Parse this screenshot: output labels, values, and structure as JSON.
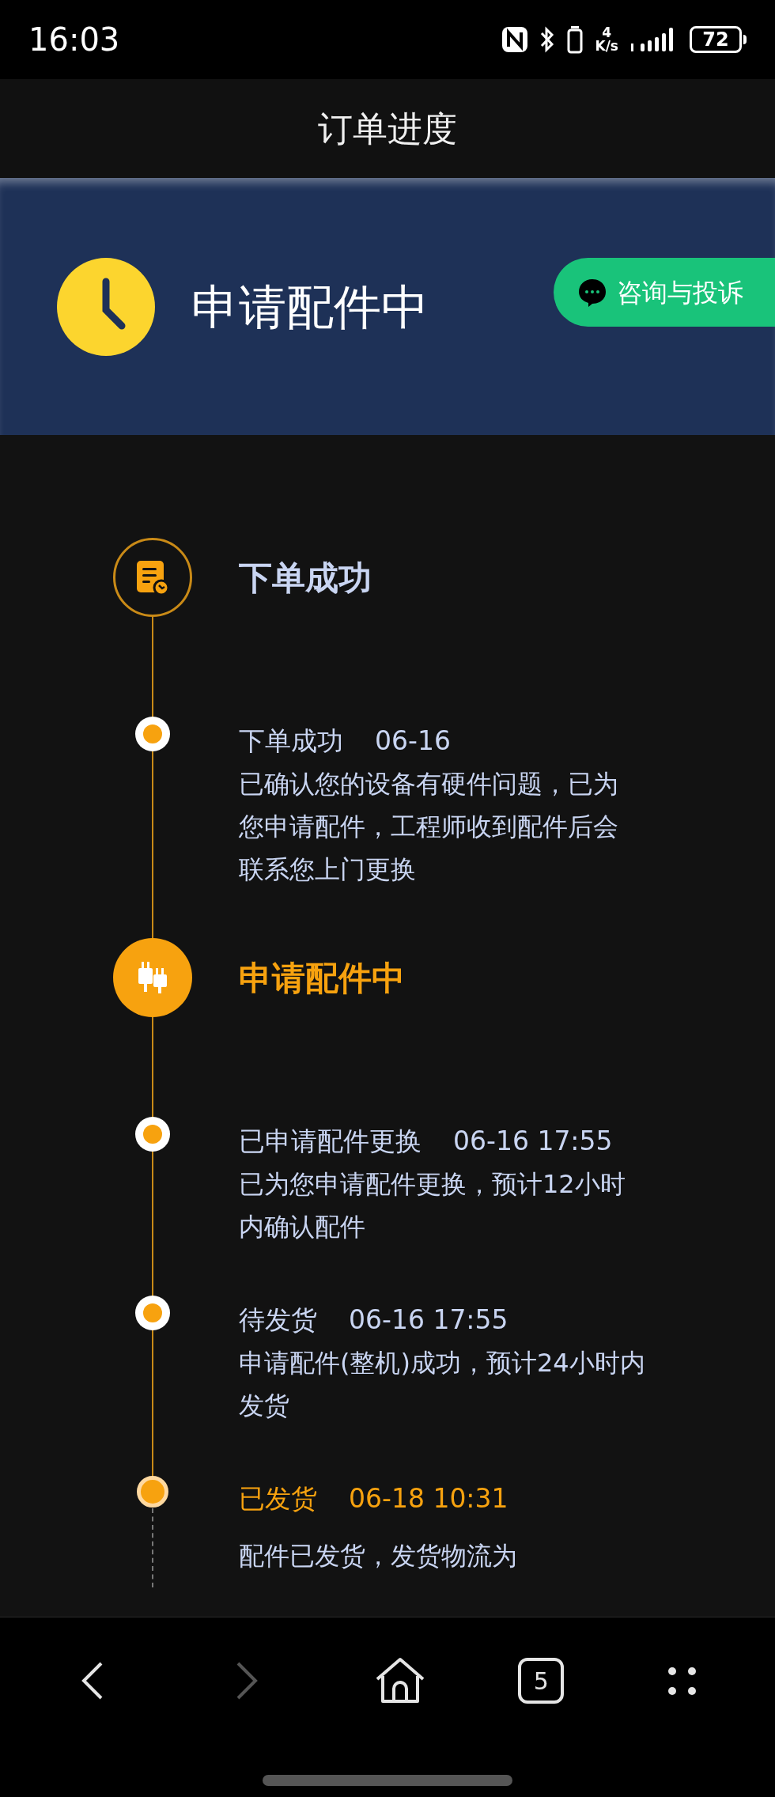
{
  "status_bar": {
    "time": "16:03",
    "speed_value": "4",
    "speed_unit": "K/s",
    "battery": "72"
  },
  "title_bar": {
    "title": "订单进度"
  },
  "banner": {
    "status": "申请配件中",
    "button": "咨询与投诉"
  },
  "stages": [
    {
      "title": "下单成功",
      "kind": "order",
      "active": false,
      "items": [
        {
          "title": "下单成功",
          "time": "06-16",
          "highlighted": false,
          "description_lines": [
            "已确认您的设备有硬件问题，已为",
            "您申请配件，工程师收到配件后会",
            "联系您上门更换"
          ]
        }
      ]
    },
    {
      "title": "申请配件中",
      "kind": "parts",
      "active": true,
      "items": [
        {
          "title": "已申请配件更换",
          "time": "06-16 17:55",
          "highlighted": false,
          "description_lines": [
            "已为您申请配件更换，预计12小时",
            "内确认配件"
          ]
        },
        {
          "title": "待发货",
          "time": "06-16 17:55",
          "highlighted": false,
          "description_lines": [
            "申请配件(整机)成功，预计24小时内",
            "发货"
          ]
        },
        {
          "title": "已发货",
          "time": "06-18 10:31",
          "highlighted": true,
          "description_lines": [
            "配件已发货，发货物流为"
          ]
        }
      ]
    }
  ],
  "bottom_nav": {
    "back_enabled": true,
    "forward_enabled": false,
    "tab_count": "5"
  }
}
